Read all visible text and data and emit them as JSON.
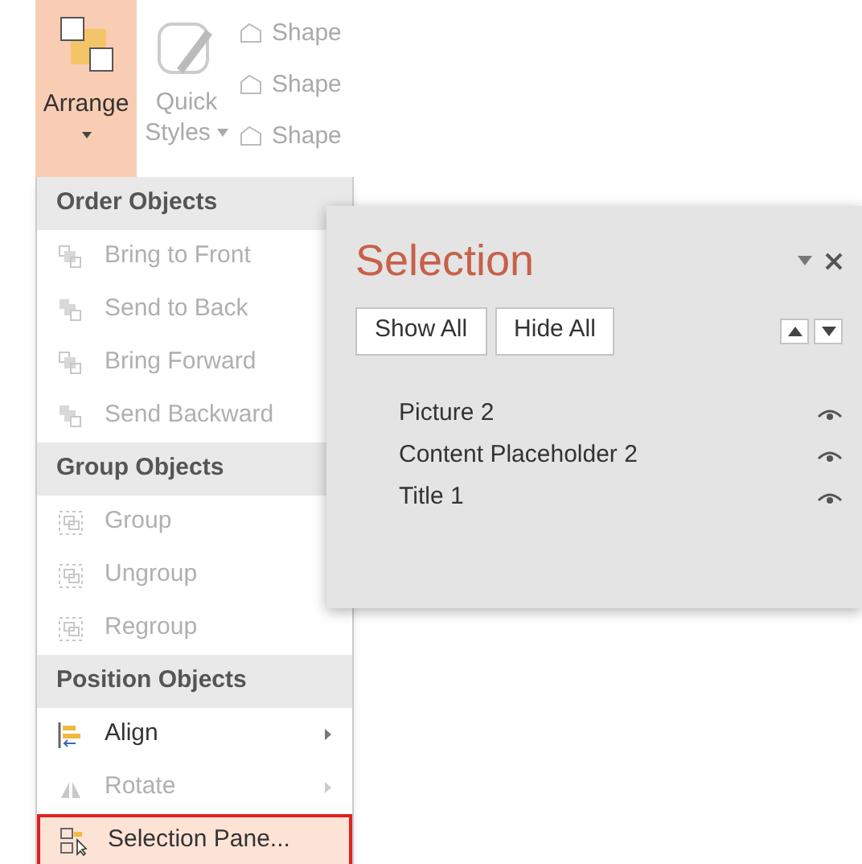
{
  "ribbon": {
    "arrange_button": {
      "label": "Arrange",
      "selected": true
    },
    "quick_styles_button": {
      "label": "Quick",
      "label_2": "Styles"
    },
    "shape_buttons": [
      "Shape",
      "Shape",
      "Shape"
    ]
  },
  "menu": [
    {
      "kind": "header",
      "label": "Order Objects"
    },
    {
      "kind": "item",
      "label": "Bring to Front",
      "disabled": true,
      "submenu": false,
      "selected": false
    },
    {
      "kind": "item",
      "label": "Send to Back",
      "disabled": true,
      "submenu": false,
      "selected": false
    },
    {
      "kind": "item",
      "label": "Bring Forward",
      "disabled": true,
      "submenu": false,
      "selected": false
    },
    {
      "kind": "item",
      "label": "Send Backward",
      "disabled": true,
      "submenu": false,
      "selected": false
    },
    {
      "kind": "header",
      "label": "Group Objects"
    },
    {
      "kind": "item",
      "label": "Group",
      "disabled": true,
      "submenu": false,
      "selected": false
    },
    {
      "kind": "item",
      "label": "Ungroup",
      "disabled": true,
      "submenu": false,
      "selected": false
    },
    {
      "kind": "item",
      "label": "Regroup",
      "disabled": true,
      "submenu": false,
      "selected": false
    },
    {
      "kind": "header",
      "label": "Position Objects"
    },
    {
      "kind": "item",
      "label": "Align",
      "disabled": false,
      "submenu": true,
      "selected": false
    },
    {
      "kind": "item",
      "label": "Rotate",
      "disabled": true,
      "submenu": true,
      "selected": false
    },
    {
      "kind": "item",
      "label": "Selection Pane...",
      "disabled": false,
      "submenu": false,
      "selected": true
    }
  ],
  "selection_pane": {
    "title": "Selection",
    "buttons": [
      "Show All",
      "Hide All"
    ],
    "objects": [
      {
        "name": "Picture 2",
        "visible": true
      },
      {
        "name": "Content Placeholder 2",
        "visible": true
      },
      {
        "name": "Title 1",
        "visible": true
      }
    ]
  }
}
